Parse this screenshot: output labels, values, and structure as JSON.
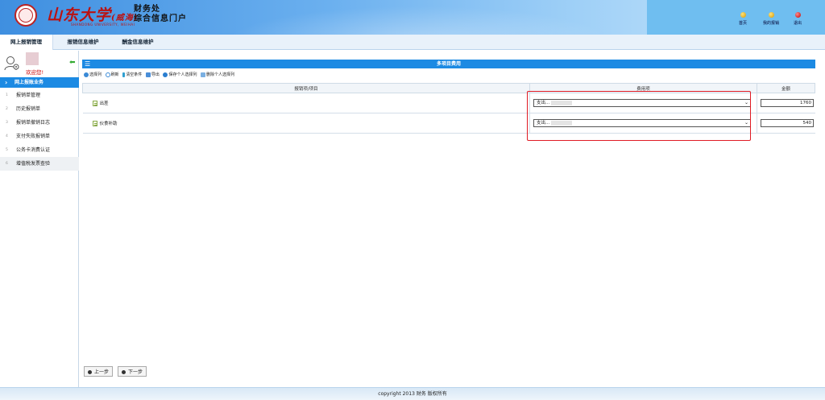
{
  "header": {
    "logo_text": "山东大学",
    "logo_sub": "(威海)",
    "logo_en": "SHANDONG UNIVERSITY, WEIHAI",
    "system_title_line1": "财务处",
    "system_title_line2": "综合信息门户",
    "links": [
      {
        "label": "首页",
        "icon": "home-icon"
      },
      {
        "label": "我的报销",
        "icon": "my-reimburse-icon"
      },
      {
        "label": "退出",
        "icon": "exit-icon"
      }
    ]
  },
  "tabs": [
    "网上报销管理",
    "报销信息维护",
    "酬金信息维护"
  ],
  "sidebar": {
    "welcome": "欢迎您!",
    "active_section": "网上报账业务",
    "items": [
      {
        "num": "1",
        "label": "报销单管理"
      },
      {
        "num": "2",
        "label": "历史报销单"
      },
      {
        "num": "3",
        "label": "报销单撤销日志"
      },
      {
        "num": "4",
        "label": "支付失败报销单"
      },
      {
        "num": "5",
        "label": "公务卡消费认证"
      },
      {
        "num": "6",
        "label": "增值税发票查验"
      }
    ]
  },
  "panel": {
    "title": "多项目费用",
    "toolbar": [
      "选择列",
      "刷新",
      "清空条件",
      "导出",
      "保存个人选择列",
      "删除个人选择列"
    ],
    "columns": [
      "报销项/项目",
      "费用项",
      "金额"
    ],
    "rows": [
      {
        "name": "出差",
        "fee_item": "支出...",
        "amount": "1760"
      },
      {
        "name": "伙食补助",
        "fee_item": "支出...",
        "amount": "540"
      }
    ],
    "prev_label": "上一步",
    "next_label": "下一步"
  },
  "footer": "copyright 2013 财务 版权所有",
  "colors": {
    "accent": "#1c8ae3",
    "highlight": "#e01b24"
  }
}
